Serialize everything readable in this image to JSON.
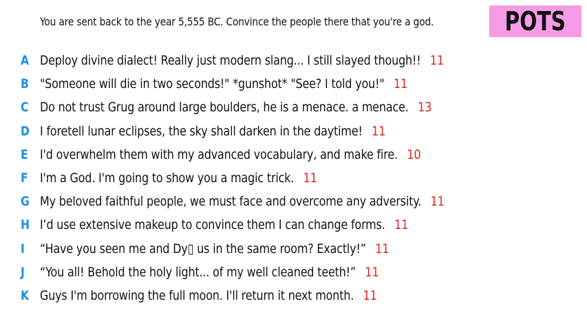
{
  "prompt": "You are sent back to the year 5,555 BC. Convince the people there that you're a god.",
  "badge": "POTS",
  "colors": {
    "letter": "#1a8fe0",
    "score": "#e3211c",
    "badge_bg": "#f79be7",
    "text": "#111111"
  },
  "answers": [
    {
      "letter": "A",
      "text": "Deploy divine dialect! Really just modern slang... I still slayed though!!",
      "score": "11"
    },
    {
      "letter": "B",
      "text": "\"Someone will die in two seconds!\" *gunshot* \"See? I told you!\"",
      "score": "11"
    },
    {
      "letter": "C",
      "text": "Do not trust Grug around large boulders, he is a menace. a menace.",
      "score": "13"
    },
    {
      "letter": "D",
      "text": "I foretell lunar eclipses, the sky shall darken in the daytime!",
      "score": "11"
    },
    {
      "letter": "E",
      "text": "I'd overwhelm them with my advanced vocabulary, and make fire.",
      "score": "10"
    },
    {
      "letter": "F",
      "text": "I'm a God. I'm going to show you a magic trick.",
      "score": "11"
    },
    {
      "letter": "G",
      "text": "My beloved faithful people, we must face and overcome any adversity.",
      "score": "11"
    },
    {
      "letter": "H",
      "text": "I’d use extensive makeup to convince them I can change forms.",
      "score": "11"
    },
    {
      "letter": "I",
      "text": "“Have you seen me and Dy▯ us in the same room? Exactly!”",
      "score": "11"
    },
    {
      "letter": "J",
      "text": "“You all! Behold the holy light... of my well cleaned teeth!”",
      "score": "11"
    },
    {
      "letter": "K",
      "text": "Guys I'm borrowing the full moon. I'll return it next month.",
      "score": "11"
    }
  ]
}
